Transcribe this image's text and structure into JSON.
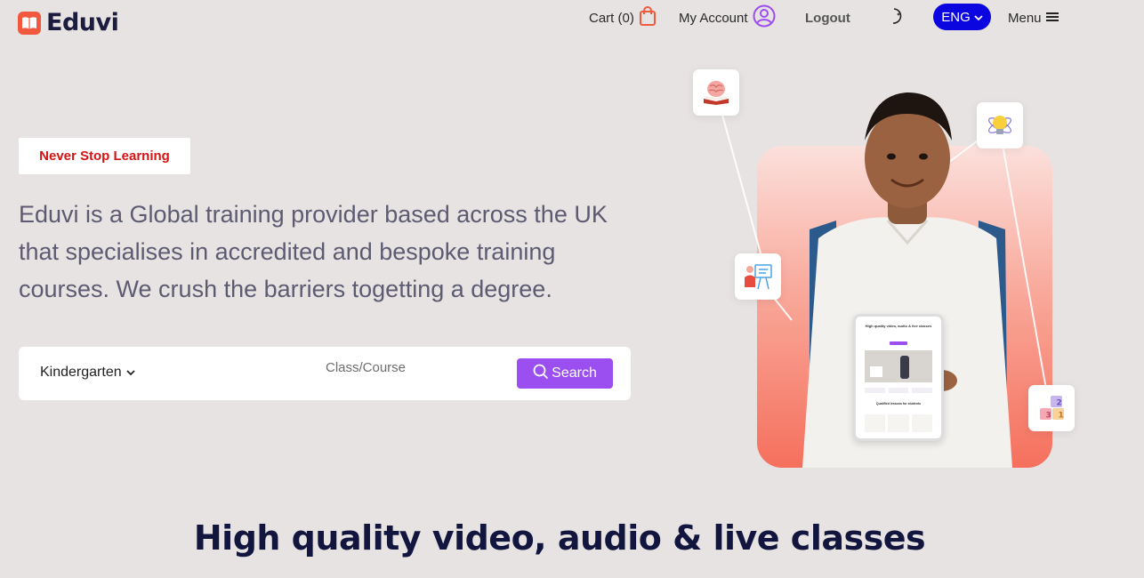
{
  "brand": {
    "name": "Eduvi"
  },
  "nav": {
    "cart_label": "Cart (0)",
    "account_label": "My Account",
    "logout_label": "Logout",
    "language_label": "ENG",
    "menu_label": "Menu"
  },
  "hero": {
    "tagline": "Never Stop Learning",
    "description": "Eduvi is a Global training provider based across the UK that specialises in accredited and bespoke training courses. We crush the barriers togetting a degree."
  },
  "search": {
    "level_value": "Kindergarten",
    "placeholder": "Class/Course",
    "button_label": "Search"
  },
  "tablet": {
    "headline": "High quality video, audio & live classes",
    "section": "Qualified lessons for students"
  },
  "section": {
    "title": "High quality video, audio & live classes"
  },
  "colors": {
    "accent": "#9b4ff0",
    "brand": "#f2583e",
    "tagline": "#d51414",
    "language_button": "#0b05e0"
  }
}
